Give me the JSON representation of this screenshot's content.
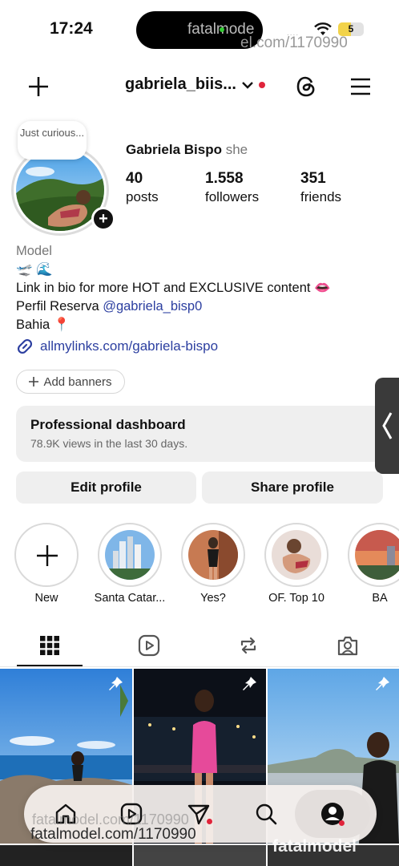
{
  "status_bar": {
    "time": "17:24",
    "island_text": "fatalmode",
    "watermark": "el.com/1170990",
    "signal": "....",
    "battery_level": "5"
  },
  "header": {
    "username": "gabriela_biis...",
    "icons": [
      "plus-icon",
      "chevron-down-icon",
      "threads-icon",
      "menu-icon"
    ]
  },
  "profile": {
    "note": "Just curious...",
    "display_name": "Gabriela Bispo",
    "pronoun": "she",
    "stats": [
      {
        "value": "40",
        "label": "posts"
      },
      {
        "value": "1.558",
        "label": "followers"
      },
      {
        "value": "351",
        "label": "friends"
      }
    ],
    "category": "Model",
    "emoji_line": "🛫 🌊",
    "bio_line1": "Link in bio for more HOT and EXCLUSIVE content 👄",
    "bio_line2_prefix": "Perfil Reserva ",
    "bio_mention": "@gabriela_bisp0",
    "bio_line3": "Bahia 📍",
    "link": "allmylinks.com/gabriela-bispo",
    "add_banners": "Add banners"
  },
  "dashboard": {
    "title": "Professional dashboard",
    "subtitle": "78.9K views in the last 30 days."
  },
  "actions": {
    "edit": "Edit profile",
    "share": "Share profile"
  },
  "highlights": [
    {
      "label": "New"
    },
    {
      "label": "Santa Catar..."
    },
    {
      "label": "Yes?"
    },
    {
      "label": "OF. Top 10"
    },
    {
      "label": "BA"
    }
  ],
  "tabs": [
    "grid-icon",
    "reels-icon",
    "reposts-icon",
    "tagged-icon"
  ],
  "watermarks": {
    "bottom": "fatalmodel.com/1170990",
    "faint": "fatalmodel.com/1170990",
    "logo": "fatalmodel"
  },
  "colors": {
    "link_blue": "#2c3fa0",
    "notification_red": "#e0243b",
    "button_gray": "#efefef"
  }
}
